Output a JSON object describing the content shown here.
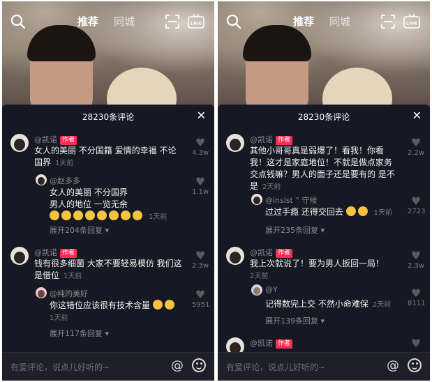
{
  "top": {
    "tab_recommend": "推荐",
    "tab_city": "同城",
    "live": "LIVE"
  },
  "left": {
    "panel_title": "28230条评论",
    "comments": [
      {
        "user": "@凯诺",
        "badge": "作者",
        "text": "女人的美丽 不分国籍 爱情的幸福 不论国界",
        "time": "1天前",
        "likes": "4.3w"
      },
      {
        "user": "@赵多多",
        "text_line1": "女人的美丽 不分国界",
        "text_line2": "男人的地位 一览无余",
        "time": "1天前",
        "likes": "1.1w"
      },
      {
        "expand": "展开204条回复"
      },
      {
        "user": "@凯诺",
        "badge": "作者",
        "text": "钱有很多细菌 大家不要轻易模仿 我们这是借位",
        "time": "1天前",
        "likes": "2.3w"
      },
      {
        "user": "@纯的美好",
        "text": "你这错位应该很有技术含量",
        "time": "1天前",
        "likes": "5951"
      },
      {
        "expand": "展开117条回复"
      }
    ],
    "input_placeholder": "有爱评论，说点儿好听的~"
  },
  "right": {
    "panel_title": "28230条评论",
    "comments": [
      {
        "user": "@凯诺",
        "badge": "作者",
        "text": "其他小哥哥真是弱爆了！看我！你看我！这才是家庭地位！不就是做点家务交点钱嘛？男人的面子还是要有的 是不是",
        "time": "2天前",
        "likes": "2.2w"
      },
      {
        "user": "@insist ° 守候",
        "text": "过过手瘾 还得交回去",
        "time": "1天前",
        "likes": "2723"
      },
      {
        "expand": "展开235条回复"
      },
      {
        "user": "@凯诺",
        "badge": "作者",
        "text": "我上次就说了！要为男人扳回一局！",
        "time": "2天前",
        "likes": "2.3w"
      },
      {
        "user": "@Y",
        "text": "记得数完上交 不然小命难保",
        "time": "2天前",
        "likes": "8111"
      },
      {
        "expand": "展开139条回复"
      },
      {
        "user": "@凯诺",
        "badge": "作者"
      }
    ],
    "input_placeholder": "有爱评论，说点儿好听的~"
  }
}
